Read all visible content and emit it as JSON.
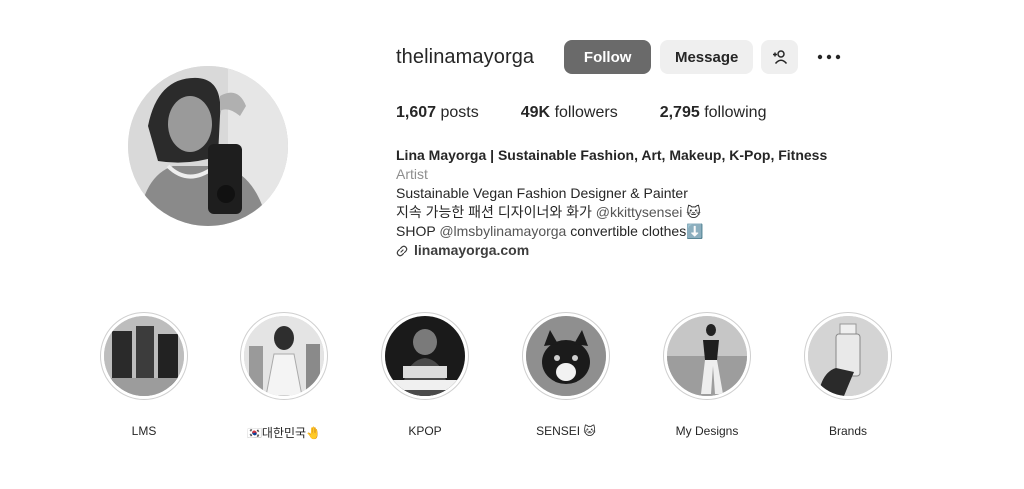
{
  "profile": {
    "username": "thelinamayorga",
    "follow_label": "Follow",
    "message_label": "Message",
    "add_user_icon": "add-user-icon",
    "more_icon": "more-options-icon"
  },
  "stats": {
    "posts_count": "1,607",
    "posts_label": "posts",
    "followers_count": "49K",
    "followers_label": "followers",
    "following_count": "2,795",
    "following_label": "following"
  },
  "bio": {
    "name": "Lina Mayorga | Sustainable Fashion, Art, Makeup, K-Pop, Fitness",
    "category": "Artist",
    "line1": "Sustainable Vegan Fashion Designer & Painter",
    "line2_text": "지속 가능한 패션 디자이너와 화가 ",
    "line2_mention": "@kkittysensei",
    "line2_emoji": " 🐱",
    "line3_prefix": "SHOP ",
    "line3_mention": "@lmsbylinamayorga",
    "line3_suffix": " convertible clothes⬇️",
    "link": "linamayorga.com"
  },
  "highlights": [
    {
      "label": "LMS"
    },
    {
      "label": "🇰🇷대한민국🤚"
    },
    {
      "label": "KPOP"
    },
    {
      "label": "SENSEI 🐱"
    },
    {
      "label": "My Designs"
    },
    {
      "label": "Brands"
    }
  ]
}
